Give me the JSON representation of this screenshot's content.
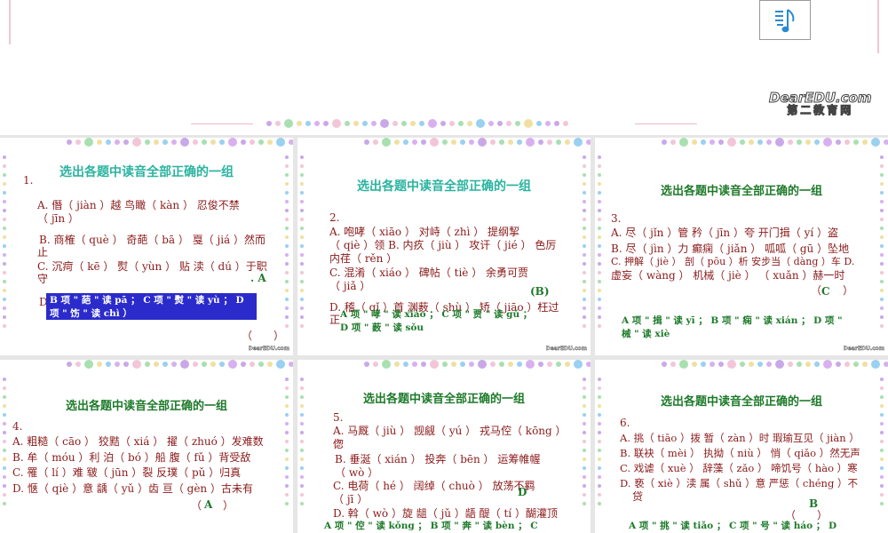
{
  "header": {
    "logo_text": "DearEDU.com",
    "logo_sub": "第二教育网",
    "music_button": "music-notes-icon"
  },
  "slides": [
    {
      "title": "选出各题中读音全部正确的一组",
      "number": "1.",
      "lines": [
        "A. 僭（ jiàn ）越 鸟瞰（ kàn ） 忍俊不禁",
        "（ jīn ）",
        "B. 商榷（ què ） 奇葩（ bā ） 戛（ jiá ）然而",
        "止",
        "C. 沉疴（ kē ） 熨（ yùn ） 贴 渎（ dú ）于职",
        "守",
        "D",
        "（"
      ],
      "answer": ". A",
      "note": "B 项 \" 葩 \" 读 pā ； C 项 \" 熨 \" 读 yù ； D 项 \" 饬 \" 读 chì ）",
      "paren": "（　　）"
    },
    {
      "title": "选出各题中读音全部正确的一组",
      "number": "2.",
      "lines": [
        "A. 咆哮（ xiāo ） 对峙（ zhì ） 提纲挈",
        "（ qiè ）领 B. 内疚（ jiù ） 攻讦（ jié ） 色厉",
        "内荏（ rěn ）",
        "C. 混淆（ xiáo ） 碑帖（ tiè ） 余勇可贾",
        "（ jiǎ ）",
        "D. 稽（ qǐ ）首 渊薮（ shù ） 矫（ jiāo ）枉过",
        "正"
      ],
      "answer": "(B)",
      "note": "A 项 \" 哮 \" 读 xiào ； C 项 \" 贾 \" 读 gǔ ； D 项 \" 薮 \" 读 sǒu"
    },
    {
      "title": "选出各题中读音全部正确的一组",
      "number": "3.",
      "lines": [
        "A. 尽（ jǐn ）管 矜（ jīn ）夸 开门揖（ yí ）盗",
        "B. 尽（ jìn ）力 癫痫（ jiǎn ） 呱呱（ gū ）坠地",
        "C. 押解（ jiè ） 剖（ pōu ）析 安步当（ dàng ）车 D.",
        "虚妄（ wàng ） 机械（ jiè ） （ xuǎn ）赫一时"
      ],
      "answer": "C",
      "paren": "（　　）",
      "note": "A 项 \" 揖 \" 读 yī ； B 项 \" 痫 \" 读 xián ； D 项 \" 械 \" 读 xiè"
    },
    {
      "title": "选出各题中读音全部正确的一组",
      "number": "4.",
      "lines": [
        "A. 粗糙（ cāo ） 狡黠（ xiá ） 擢（ zhuó ）发难数",
        "B. 牟（ móu ）利 泊（ bó ）船 腹（ fǔ ）背受敌",
        "C. 罹（ lí ）难 皲（ jūn ）裂 反璞（ pǔ ）归真",
        "D. 惬（ qiè ）意 龋（ yǔ ）齿 亘（ gèn ）古未有"
      ],
      "answer": "A",
      "paren": "（　　）"
    },
    {
      "title": "选出各题中读音全部正确的一组",
      "number": "5.",
      "lines": [
        "A. 马厩（ jiù ） 觊觎（ yú ） 戎马倥（ kōng ）",
        "偬",
        "B. 垂涎（ xián ） 投奔（ bēn ） 运筹帷幄",
        "（ wò ）",
        "C. 电荷（ hé ） 阔绰（ chuò ） 放荡不羁",
        "（ jī ）",
        "D. 斡（ wò ）旋 龃（ jǔ ）龉 醍（ tí ）醐灌顶"
      ],
      "answer": "D",
      "note": "A 项 \" 倥 \" 读 kǒng ； B 项 \" 奔 \" 读 bèn ； C"
    },
    {
      "title": "选出各题中读音全部正确的一组",
      "number": "6.",
      "lines": [
        "A. 挑（ tiāo ）拨 暂（ zàn ）时 瑕瑜互见（ jiàn ）",
        "B. 联袂（ mèi ） 执拗（ niù ） 悄（ qiǎo ）然无声",
        "C. 戏谑（ xuè ） 辞藻（ zǎo ） 啼饥号（ hào ）寒",
        "D. 亵（ xiè ）渎 属（ shǔ ）意 严惩（ chéng ）不",
        "贷"
      ],
      "answer": "B",
      "paren": "（　　）",
      "note": "A 项 \" 挑 \" 读 tiǎo ； C 项 \" 号 \" 读 háo ； D"
    }
  ],
  "colors": {
    "question": "#8b1a1a",
    "answer": "#1e7a2a",
    "title_teal": "#2bb3a0",
    "highlight": "#2b2bcc"
  }
}
